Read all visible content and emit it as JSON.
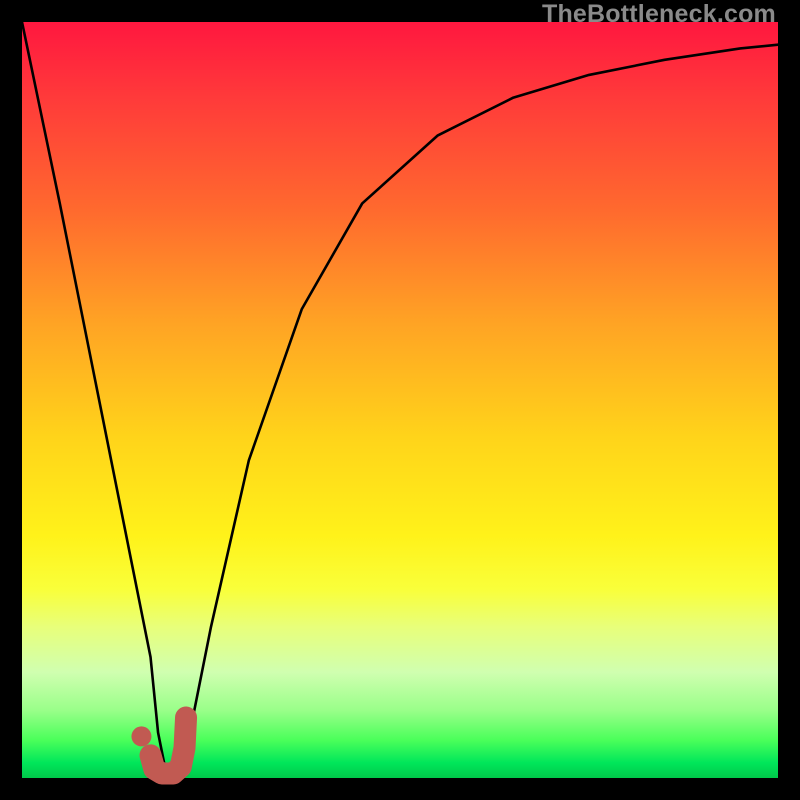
{
  "watermark": "TheBottleneck.com",
  "chart_data": {
    "type": "line",
    "title": "",
    "xlabel": "",
    "ylabel": "",
    "xlim": [
      0,
      100
    ],
    "ylim": [
      0,
      100
    ],
    "grid": false,
    "legend": false,
    "series": [
      {
        "name": "v-curve",
        "type": "line",
        "x": [
          0,
          5,
          10,
          14,
          17,
          18,
          19,
          20,
          22,
          25,
          30,
          37,
          45,
          55,
          65,
          75,
          85,
          95,
          100
        ],
        "y": [
          100,
          76,
          51,
          31,
          16,
          6,
          1,
          1,
          5,
          20,
          42,
          62,
          76,
          85,
          90,
          93,
          95,
          96.5,
          97
        ]
      },
      {
        "name": "marker-hook",
        "type": "line",
        "color": "#c15a52",
        "x": [
          17.0,
          17.5,
          18.5,
          20.0,
          21.0,
          21.5,
          21.7
        ],
        "y": [
          3.0,
          1.2,
          0.6,
          0.6,
          1.5,
          4.0,
          8.0
        ]
      },
      {
        "name": "marker-dot",
        "type": "scatter",
        "color": "#c15a52",
        "x": [
          15.8
        ],
        "y": [
          5.5
        ]
      }
    ]
  }
}
